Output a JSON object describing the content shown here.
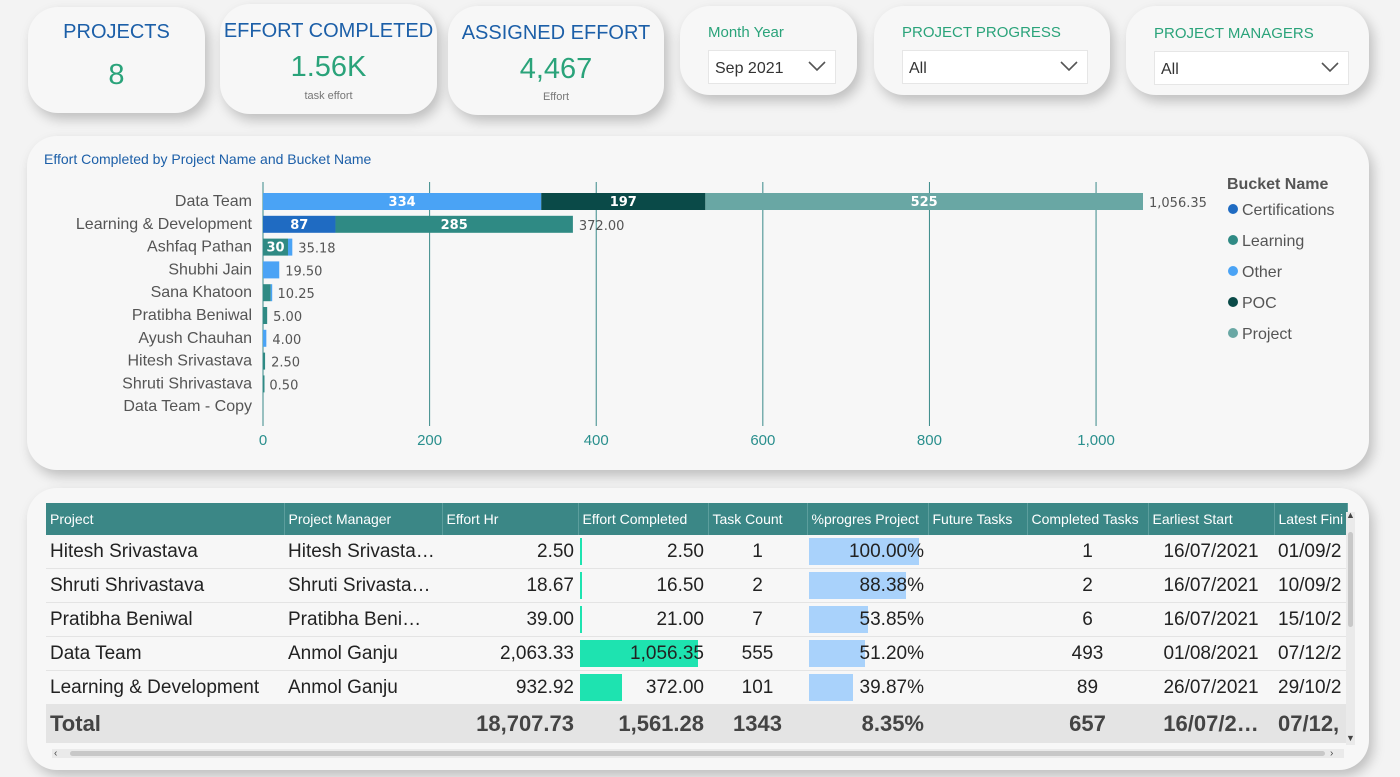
{
  "kpis": [
    {
      "title": "PROJECTS",
      "value": "8",
      "sub": ""
    },
    {
      "title": "EFFORT COMPLETED",
      "value": "1.56K",
      "sub": "task effort"
    },
    {
      "title": "ASSIGNED EFFORT",
      "value": "4,467",
      "sub": "Effort"
    }
  ],
  "slicers": [
    {
      "title": "Month Year",
      "value": "Sep 2021"
    },
    {
      "title": "PROJECT PROGRESS",
      "value": "All"
    },
    {
      "title": "PROJECT MANAGERS",
      "value": "All"
    }
  ],
  "chart_data": {
    "type": "bar",
    "orientation": "horizontal",
    "stacked": true,
    "title": "Effort Completed by Project Name and Bucket Name",
    "categories": [
      "Data Team",
      "Learning & Development",
      "Ashfaq Pathan",
      "Shubhi Jain",
      "Sana Khatoon",
      "Pratibha Beniwal",
      "Ayush Chauhan",
      "Hitesh Srivastava",
      "Shruti Shrivastava",
      "Data Team - Copy"
    ],
    "series": [
      {
        "name": "Certifications",
        "color": "#1f6bc2",
        "values": [
          0,
          87,
          0,
          0,
          0,
          0,
          0,
          0,
          0,
          0
        ]
      },
      {
        "name": "Learning",
        "color": "#2f8a84",
        "values": [
          0,
          285,
          30,
          0,
          9.25,
          5,
          0,
          2.5,
          0.5,
          0
        ]
      },
      {
        "name": "Other",
        "color": "#4aa3f5",
        "values": [
          334,
          0,
          5.18,
          19.5,
          1,
          0,
          4,
          0,
          0,
          0
        ]
      },
      {
        "name": "POC",
        "color": "#0a4a48",
        "values": [
          197,
          0,
          0,
          0,
          0,
          0,
          0,
          0,
          0,
          0
        ]
      },
      {
        "name": "Project",
        "color": "#69a7a4",
        "values": [
          525.35,
          0,
          0,
          0,
          0,
          0,
          0,
          0,
          0,
          0
        ]
      }
    ],
    "segment_labels": [
      {
        "category": "Data Team",
        "series": "Other",
        "text": "334"
      },
      {
        "category": "Data Team",
        "series": "POC",
        "text": "197"
      },
      {
        "category": "Data Team",
        "series": "Project",
        "text": "525"
      },
      {
        "category": "Learning & Development",
        "series": "Certifications",
        "text": "87"
      },
      {
        "category": "Learning & Development",
        "series": "Learning",
        "text": "285"
      },
      {
        "category": "Ashfaq Pathan",
        "series": "Learning",
        "text": "30"
      }
    ],
    "totals": [
      "1,056.35",
      "372.00",
      "35.18",
      "19.50",
      "10.25",
      "5.00",
      "4.00",
      "2.50",
      "0.50",
      ""
    ],
    "xlim": [
      0,
      1056.35
    ],
    "xticks": [
      0,
      200,
      400,
      600,
      800,
      1000
    ],
    "xtick_labels": [
      "0",
      "200",
      "400",
      "600",
      "800",
      "1,000"
    ],
    "legend_title": "Bucket Name",
    "legend_position": "right",
    "grid": true
  },
  "table": {
    "headers": [
      "Project",
      "Project Manager",
      "Effort Hr",
      "Effort Completed",
      "Task Count",
      "%progres Project",
      "Future Tasks",
      "Completed Tasks",
      "Earliest Start",
      "Latest Fini"
    ],
    "rows": [
      {
        "project": "Hitesh Srivastava",
        "manager": "Hitesh Srivasta…",
        "effort_hr": "2.50",
        "effort_completed": "2.50",
        "effort_completed_value": 2.5,
        "task_count": "1",
        "progress": "100.00%",
        "progress_value": 100.0,
        "future_tasks": "",
        "completed_tasks": "1",
        "earliest_start": "16/07/2021",
        "latest_finish": "01/09/2"
      },
      {
        "project": "Shruti Shrivastava",
        "manager": "Shruti Srivasta…",
        "effort_hr": "18.67",
        "effort_completed": "16.50",
        "effort_completed_value": 16.5,
        "task_count": "2",
        "progress": "88.38%",
        "progress_value": 88.38,
        "future_tasks": "",
        "completed_tasks": "2",
        "earliest_start": "16/07/2021",
        "latest_finish": "10/09/2"
      },
      {
        "project": "Pratibha Beniwal",
        "manager": "Pratibha Beni…",
        "effort_hr": "39.00",
        "effort_completed": "21.00",
        "effort_completed_value": 21.0,
        "task_count": "7",
        "progress": "53.85%",
        "progress_value": 53.85,
        "future_tasks": "",
        "completed_tasks": "6",
        "earliest_start": "16/07/2021",
        "latest_finish": "15/10/2"
      },
      {
        "project": "Data Team",
        "manager": "Anmol Ganju",
        "effort_hr": "2,063.33",
        "effort_completed": "1,056.35",
        "effort_completed_value": 1056.35,
        "task_count": "555",
        "progress": "51.20%",
        "progress_value": 51.2,
        "future_tasks": "",
        "completed_tasks": "493",
        "earliest_start": "01/08/2021",
        "latest_finish": "07/12/2"
      },
      {
        "project": "Learning & Development",
        "manager": "Anmol Ganju",
        "effort_hr": "932.92",
        "effort_completed": "372.00",
        "effort_completed_value": 372.0,
        "task_count": "101",
        "progress": "39.87%",
        "progress_value": 39.87,
        "future_tasks": "",
        "completed_tasks": "89",
        "earliest_start": "26/07/2021",
        "latest_finish": "29/10/2"
      }
    ],
    "total": {
      "label": "Total",
      "effort_hr": "18,707.73",
      "effort_completed": "1,561.28",
      "task_count": "1343",
      "progress": "8.35%",
      "future_tasks": "",
      "completed_tasks": "657",
      "earliest_start": "16/07/2…",
      "latest_finish": "07/12,"
    },
    "effort_bar_color": "#1ee3b0",
    "progress_bar_color": "#a9d2fb"
  }
}
